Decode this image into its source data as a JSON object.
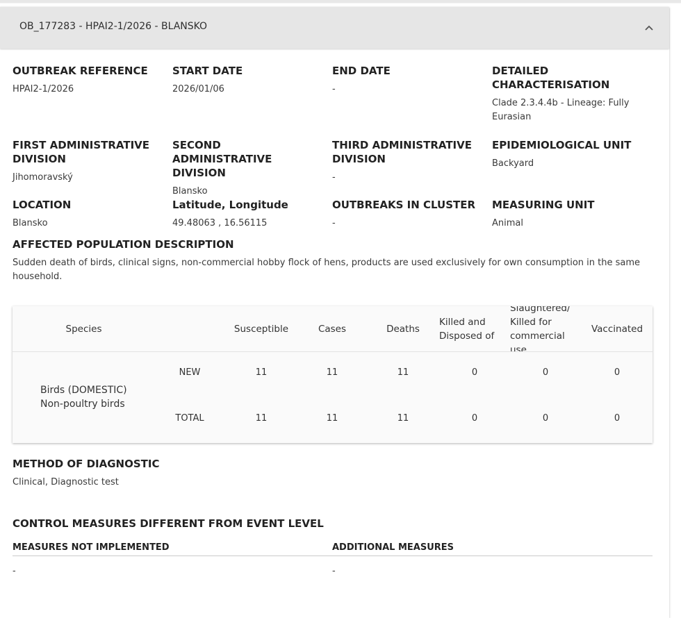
{
  "header": {
    "title": "OB_177283 - HPAI2-1/2026 - BLANSKO",
    "toggle_icon": "chevron-up-icon"
  },
  "fields": {
    "outbreak_reference": {
      "label": "OUTBREAK REFERENCE",
      "value": "HPAI2-1/2026"
    },
    "start_date": {
      "label": "START DATE",
      "value": "2026/01/06"
    },
    "end_date": {
      "label": "END DATE",
      "value": "-"
    },
    "detailed_characterisation": {
      "label": "DETAILED CHARACTERISATION",
      "value": "Clade 2.3.4.4b - Lineage: Fully Eurasian"
    },
    "first_admin_division": {
      "label": "FIRST ADMINISTRATIVE DIVISION",
      "value": "Jihomoravský"
    },
    "second_admin_division": {
      "label": "SECOND ADMINISTRATIVE DIVISION",
      "value": "Blansko"
    },
    "third_admin_division": {
      "label": "THIRD ADMINISTRATIVE DIVISION",
      "value": "-"
    },
    "epidemiological_unit": {
      "label": "EPIDEMIOLOGICAL UNIT",
      "value": "Backyard"
    },
    "location": {
      "label": "LOCATION",
      "value": "Blansko"
    },
    "lat_long": {
      "label": "Latitude, Longitude",
      "value": "49.48063 , 16.56115"
    },
    "outbreaks_in_cluster": {
      "label": "OUTBREAKS IN CLUSTER",
      "value": "-"
    },
    "measuring_unit": {
      "label": "MEASURING UNIT",
      "value": "Animal"
    }
  },
  "affected_population": {
    "label": "AFFECTED POPULATION DESCRIPTION",
    "value": "Sudden death of birds, clinical signs, non-commercial hobby flock of hens, products are used exclusively for own consumption in the same household."
  },
  "table": {
    "headers": {
      "species": "Species",
      "susceptible": "Susceptible",
      "cases": "Cases",
      "deaths": "Deaths",
      "killed": "Killed and Disposed of",
      "slaughtered": "Slaughtered/ Killed for commercial use",
      "vaccinated": "Vaccinated"
    },
    "species_name": "Birds (DOMESTIC) Non-poultry birds",
    "rows": [
      {
        "type": "NEW",
        "susceptible": "11",
        "cases": "11",
        "deaths": "11",
        "killed": "0",
        "slaughtered": "0",
        "vaccinated": "0"
      },
      {
        "type": "TOTAL",
        "susceptible": "11",
        "cases": "11",
        "deaths": "11",
        "killed": "0",
        "slaughtered": "0",
        "vaccinated": "0"
      }
    ]
  },
  "method_of_diagnostic": {
    "label": "METHOD OF DIAGNOSTIC",
    "value": "Clinical, Diagnostic test"
  },
  "control_measures": {
    "label": "CONTROL MEASURES DIFFERENT FROM EVENT LEVEL",
    "not_implemented": {
      "label": "MEASURES NOT IMPLEMENTED",
      "value": "-"
    },
    "additional": {
      "label": "ADDITIONAL MEASURES",
      "value": "-"
    }
  }
}
